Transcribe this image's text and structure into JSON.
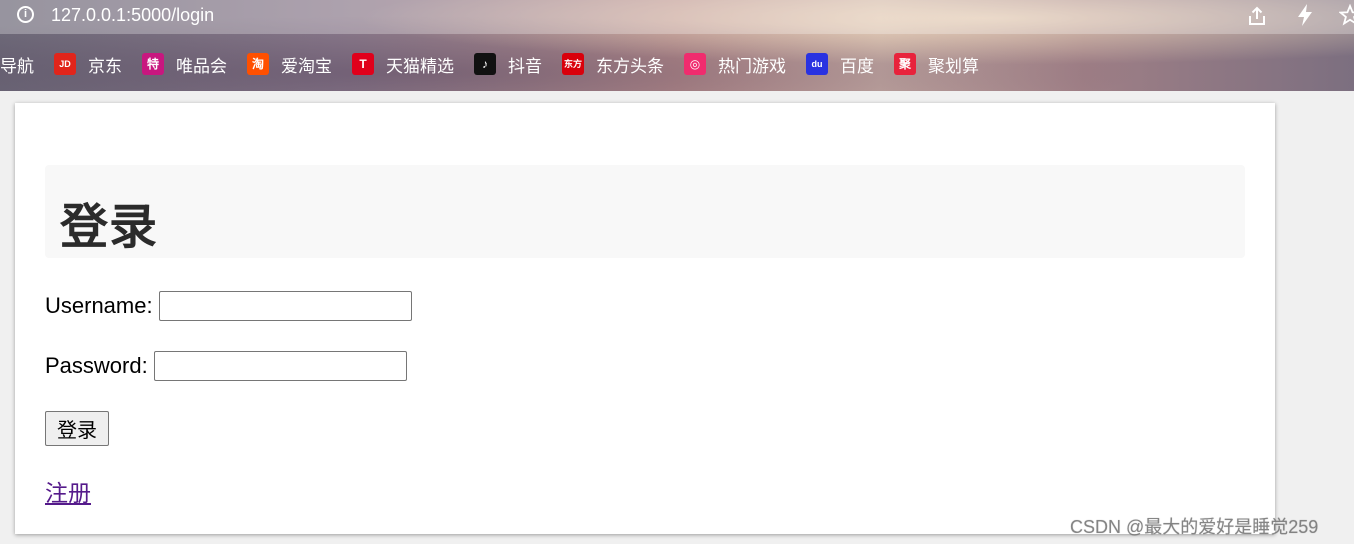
{
  "browser": {
    "url": "127.0.0.1:5000/login",
    "bookmarks": [
      {
        "label": "导航",
        "icon": "",
        "color": ""
      },
      {
        "label": "京东",
        "icon": "JD",
        "color": "#e1251b"
      },
      {
        "label": "唯品会",
        "icon": "特",
        "color": "#c8177f"
      },
      {
        "label": "爱淘宝",
        "icon": "淘",
        "color": "#ff5000"
      },
      {
        "label": "天猫精选",
        "icon": "T",
        "color": "#e0001b"
      },
      {
        "label": "抖音",
        "icon": "♪",
        "color": "#111111"
      },
      {
        "label": "东方头条",
        "icon": "东方",
        "color": "#d9000b"
      },
      {
        "label": "热门游戏",
        "icon": "◎",
        "color": "#f02c6e"
      },
      {
        "label": "百度",
        "icon": "du",
        "color": "#2932e1"
      },
      {
        "label": "聚划算",
        "icon": "聚",
        "color": "#e8233c"
      }
    ]
  },
  "page": {
    "heading": "登录",
    "username_label": "Username:",
    "username_value": "",
    "password_label": "Password:",
    "password_value": "",
    "submit_label": "登录",
    "register_link": "注册"
  },
  "watermark": "CSDN @最大的爱好是睡觉259"
}
